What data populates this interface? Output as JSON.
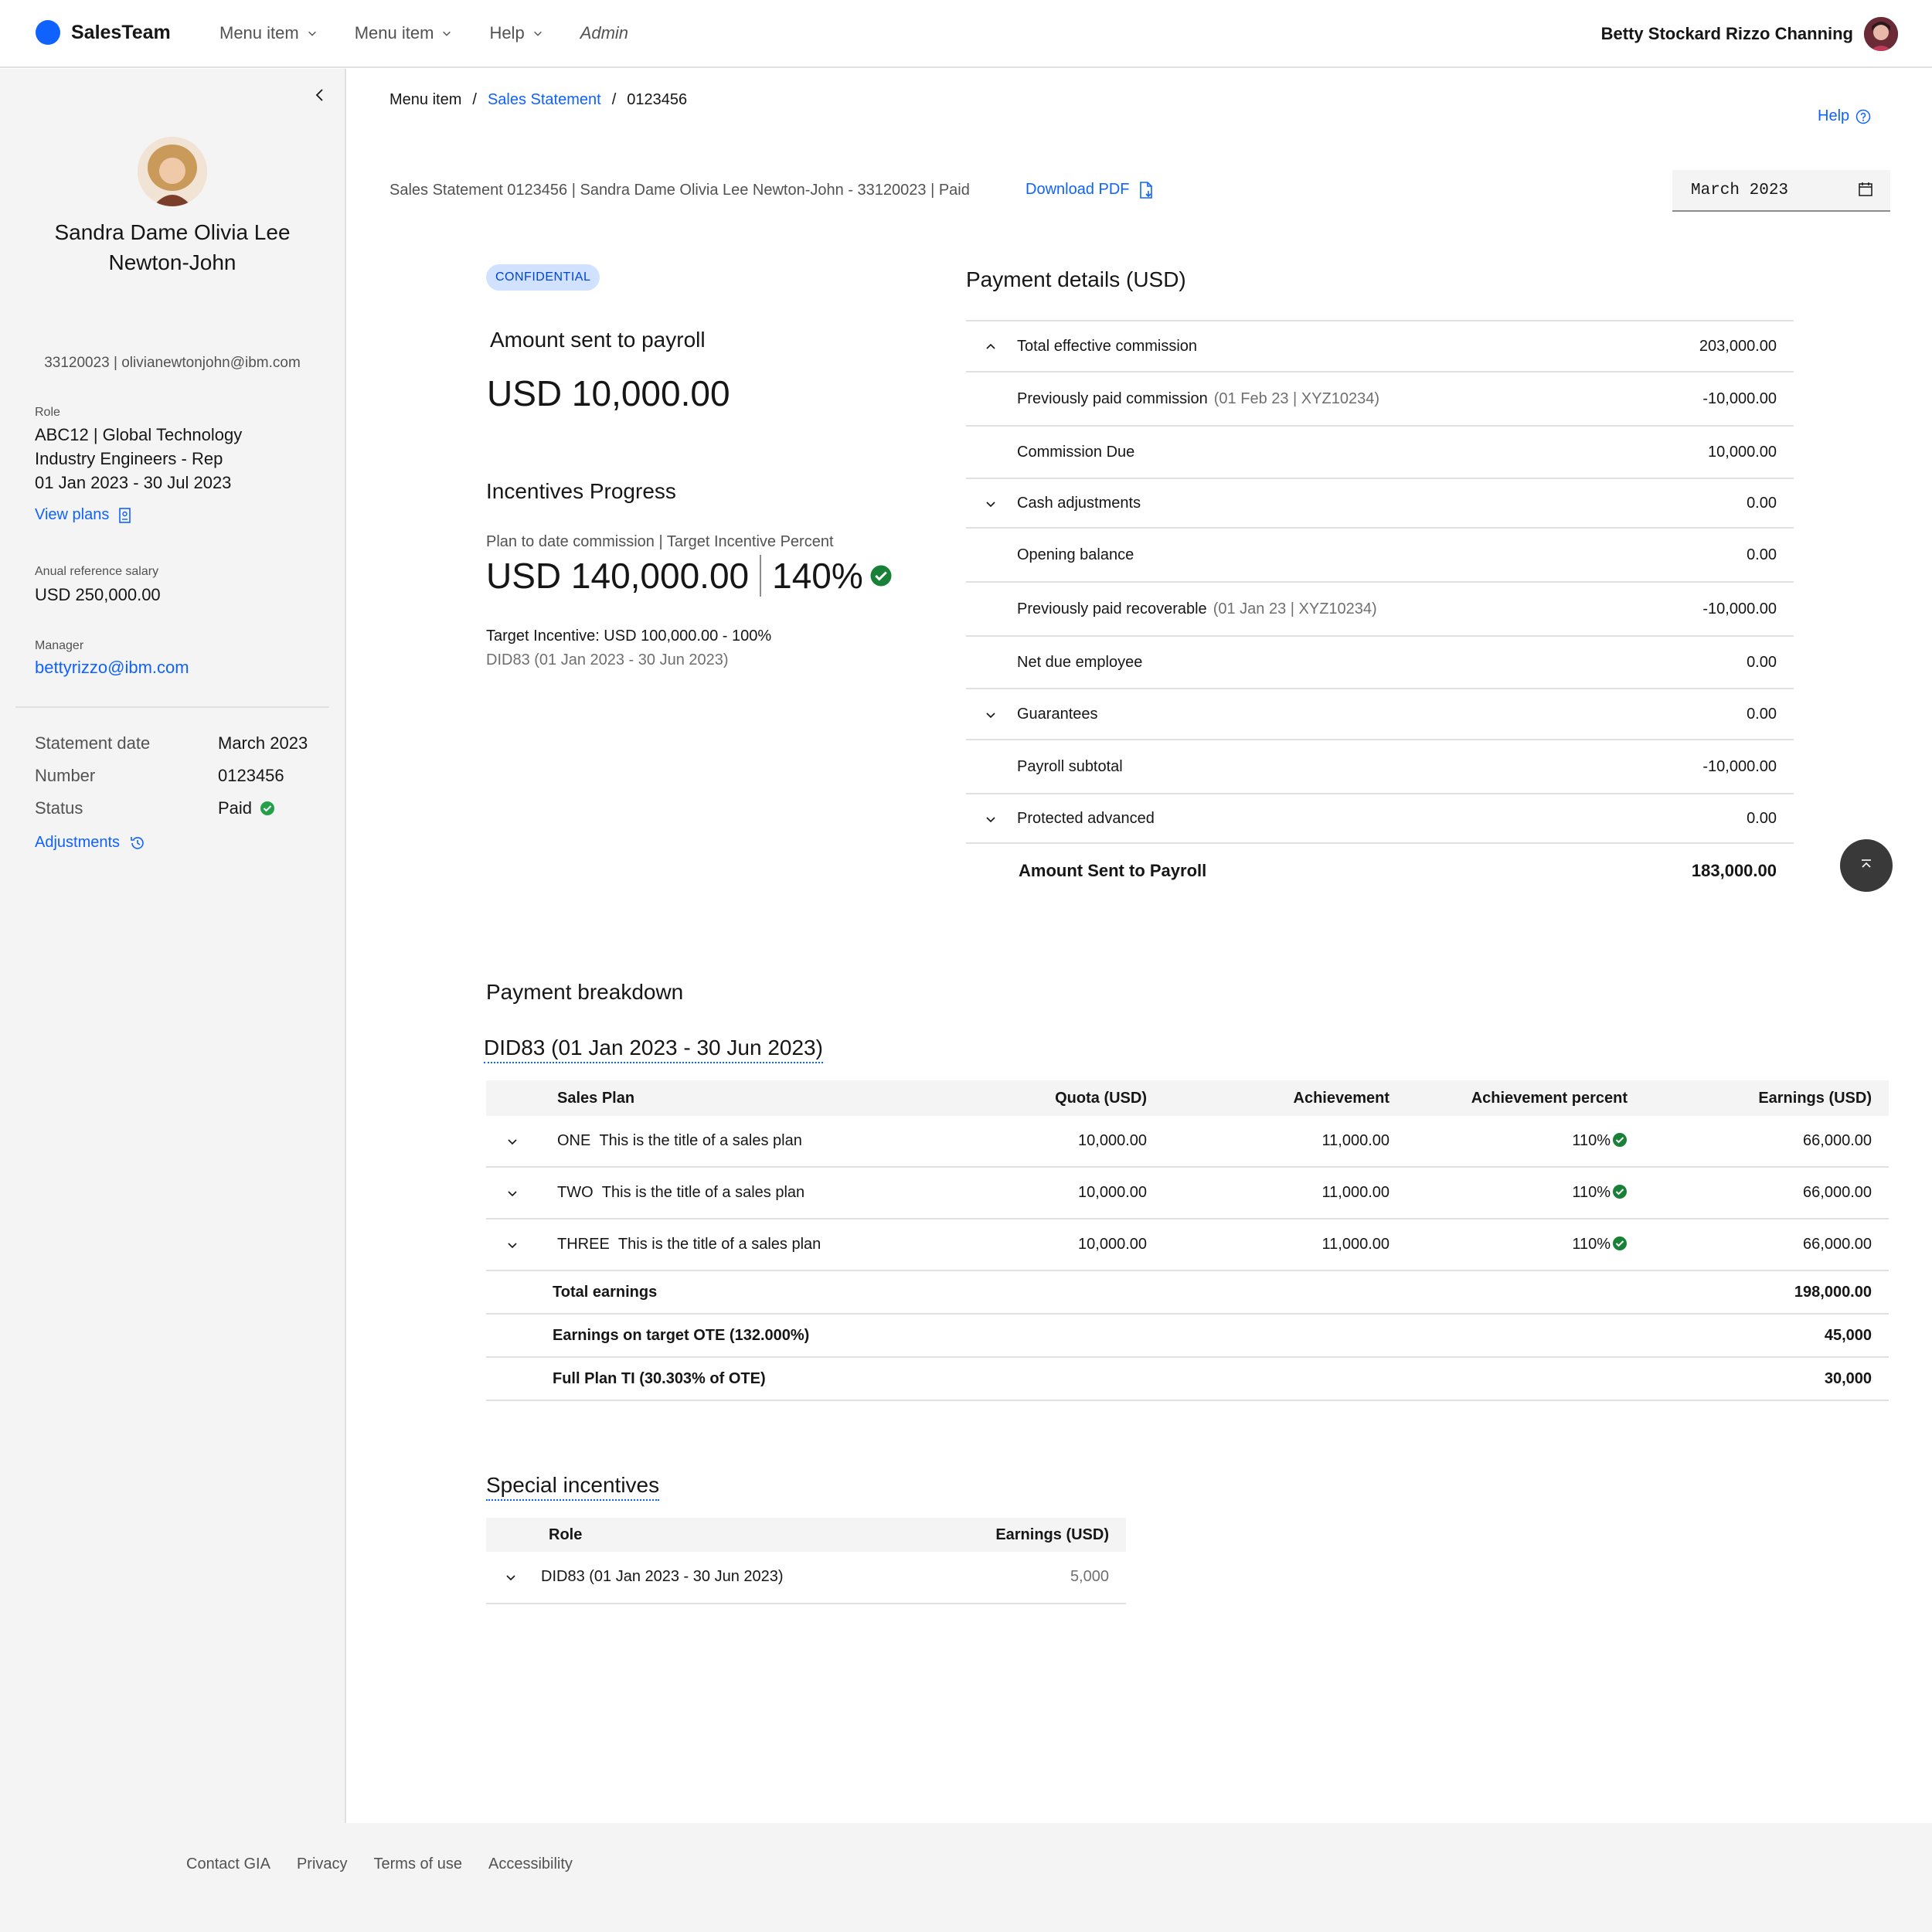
{
  "header": {
    "brand": "SalesTeam",
    "nav": [
      {
        "label": "Menu item"
      },
      {
        "label": "Menu item"
      },
      {
        "label": "Help"
      },
      {
        "label": "Admin"
      }
    ],
    "user_name": "Betty Stockard Rizzo Channing"
  },
  "sidebar": {
    "name": "Sandra Dame Olivia Lee Newton-John",
    "id_email": "33120023 | olivianewtonjohn@ibm.com",
    "role_label": "Role",
    "role_lines": [
      "ABC12 | Global Technology",
      "Industry Engineers - Rep",
      "01 Jan 2023 - 30 Jul 2023"
    ],
    "view_plans": "View plans",
    "salary_label": "Anual reference salary",
    "salary": "USD 250,000.00",
    "manager_label": "Manager",
    "manager": "bettyrizzo@ibm.com",
    "rows": [
      {
        "k": "Statement date",
        "v": "March 2023"
      },
      {
        "k": "Number",
        "v": "0123456"
      },
      {
        "k": "Status",
        "v": "Paid"
      }
    ],
    "adjustments": "Adjustments"
  },
  "breadcrumb": {
    "items": [
      "Menu item",
      "Sales Statement",
      "0123456"
    ],
    "sep": "/"
  },
  "help": "Help",
  "statement_line": "Sales Statement 0123456 | Sandra Dame Olivia Lee Newton-John - 33120023 | Paid",
  "download_pdf": "Download PDF",
  "date_picker": {
    "value": "March 2023"
  },
  "summary": {
    "tag": "CONFIDENTIAL",
    "amount_label": "Amount sent to payroll",
    "amount": "USD 10,000.00",
    "incentives_title": "Incentives Progress",
    "incentives_sub": "Plan to date commission | Target Incentive Percent",
    "plan_commission": "USD 140,000.00",
    "target_percent": "140%",
    "target_incentive": "Target Incentive: USD 100,000.00 - 100%",
    "did_period": "DID83 (01 Jan 2023 - 30 Jun 2023)"
  },
  "payment_details": {
    "title": "Payment details (USD)",
    "rows": [
      {
        "label": "Total effective commission",
        "note": "",
        "amount": "203,000.00",
        "icon": "chevron-up"
      },
      {
        "label": "Previously paid commission",
        "note": "(01 Feb 23 | XYZ10234)",
        "amount": "-10,000.00",
        "icon": ""
      },
      {
        "label": "Commission Due",
        "note": "",
        "amount": "10,000.00",
        "icon": ""
      },
      {
        "label": "Cash adjustments",
        "note": "",
        "amount": "0.00",
        "icon": "chevron-down"
      },
      {
        "label": "Opening balance",
        "note": "",
        "amount": "0.00",
        "icon": ""
      },
      {
        "label": "Previously paid recoverable",
        "note": "(01 Jan 23 | XYZ10234)",
        "amount": "-10,000.00",
        "icon": ""
      },
      {
        "label": "Net due employee",
        "note": "",
        "amount": "0.00",
        "icon": ""
      },
      {
        "label": "Guarantees",
        "note": "",
        "amount": "0.00",
        "icon": "chevron-down"
      },
      {
        "label": "Payroll subtotal",
        "note": "",
        "amount": "-10,000.00",
        "icon": ""
      },
      {
        "label": "Protected advanced",
        "note": "",
        "amount": "0.00",
        "icon": "chevron-down"
      }
    ],
    "total_label": "Amount Sent to Payroll",
    "total_amount": "183,000.00"
  },
  "breakdown": {
    "title": "Payment breakdown",
    "subtitle": "DID83 (01 Jan 2023 - 30 Jun 2023)",
    "headers": [
      "Sales Plan",
      "Quota (USD)",
      "Achievement",
      "Achievement percent",
      "Earnings (USD)"
    ],
    "rows": [
      {
        "code": "ONE",
        "plan": "This is the title of a sales plan",
        "quota": "10,000.00",
        "achievement": "11,000.00",
        "percent": "110%",
        "earnings": "66,000.00"
      },
      {
        "code": "TWO",
        "plan": "This is the title of a sales plan",
        "quota": "10,000.00",
        "achievement": "11,000.00",
        "percent": "110%",
        "earnings": "66,000.00"
      },
      {
        "code": "THREE",
        "plan": "This is the title of a sales plan",
        "quota": "10,000.00",
        "achievement": "11,000.00",
        "percent": "110%",
        "earnings": "66,000.00"
      }
    ],
    "summary": [
      {
        "label": "Total earnings",
        "value": "198,000.00"
      },
      {
        "label": "Earnings on target OTE  (132.000%)",
        "value": "45,000"
      },
      {
        "label": "Full Plan TI (30.303% of OTE)",
        "value": "30,000"
      }
    ]
  },
  "special": {
    "title": "Special incentives",
    "headers": [
      "Role",
      "Earnings (USD)"
    ],
    "rows": [
      {
        "role": "DID83 (01 Jan 2023 - 30 Jun 2023)",
        "earnings": "5,000"
      }
    ]
  },
  "footer": {
    "links": [
      "Contact GIA",
      "Privacy",
      "Terms of use",
      "Accessibility"
    ]
  },
  "colors": {
    "accent": "#0f62fe",
    "success": "#24a148",
    "tag_bg": "#d0e2ff"
  }
}
